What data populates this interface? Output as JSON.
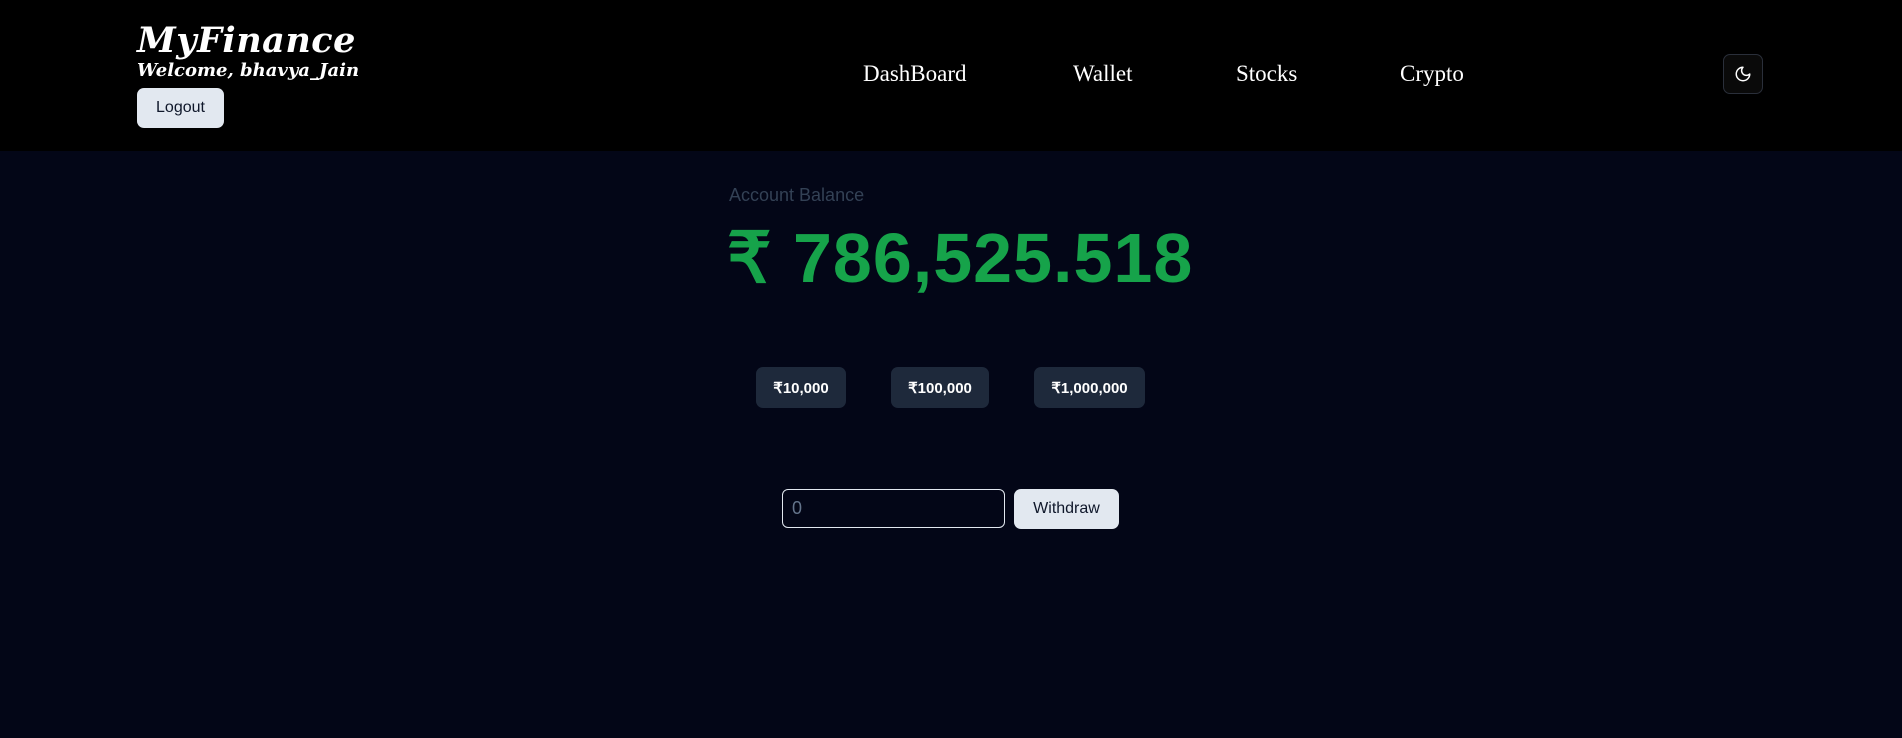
{
  "brand": {
    "title": "MyFinance",
    "welcome": "Welcome, bhavya_Jain",
    "logout_label": "Logout"
  },
  "nav": {
    "items": [
      {
        "label": "DashBoard"
      },
      {
        "label": "Wallet"
      },
      {
        "label": "Stocks"
      },
      {
        "label": "Crypto"
      }
    ]
  },
  "theme_toggle": {
    "icon": "moon-icon"
  },
  "account": {
    "label": "Account Balance",
    "balance": "₹ 786,525.518"
  },
  "quick_amounts": [
    {
      "label": "₹10,000"
    },
    {
      "label": "₹100,000"
    },
    {
      "label": "₹1,000,000"
    }
  ],
  "withdraw": {
    "placeholder": "0",
    "button_label": "Withdraw"
  },
  "colors": {
    "page_background": "#030617",
    "header_background": "#000000",
    "balance_green": "#16a34a",
    "chip_background": "#1e293b",
    "light_button": "#e2e8f0"
  }
}
